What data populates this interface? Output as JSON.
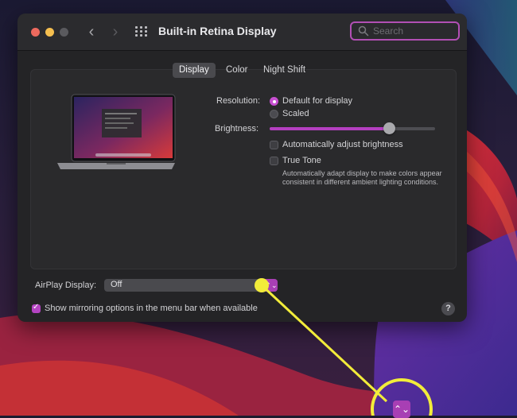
{
  "window": {
    "title": "Built-in Retina Display",
    "search_placeholder": "Search"
  },
  "icons": {
    "back": "chevron-left-icon",
    "forward": "chevron-right-icon",
    "grid": "grid-icon",
    "search": "search-icon",
    "help": "help-icon",
    "arrows": "chevron-up-down-icon"
  },
  "tabs": [
    {
      "label": "Display",
      "active": true
    },
    {
      "label": "Color",
      "active": false
    },
    {
      "label": "Night Shift",
      "active": false
    }
  ],
  "resolution": {
    "label": "Resolution:",
    "options": [
      {
        "label": "Default for display",
        "selected": true
      },
      {
        "label": "Scaled",
        "selected": false
      }
    ]
  },
  "brightness": {
    "label": "Brightness:",
    "level": 0.72
  },
  "auto_brightness": {
    "label": "Automatically adjust brightness",
    "checked": false
  },
  "true_tone": {
    "label": "True Tone",
    "checked": false,
    "description": "Automatically adapt display to make colors appear consistent in different ambient lighting conditions."
  },
  "airplay": {
    "label": "AirPlay Display:",
    "value": "Off"
  },
  "mirroring": {
    "label": "Show mirroring options in the menu bar when available",
    "checked": true
  },
  "help_label": "?",
  "colors": {
    "accent": "#b43fc0",
    "annotation": "#f2ec3a",
    "window_bg": "#242426"
  }
}
